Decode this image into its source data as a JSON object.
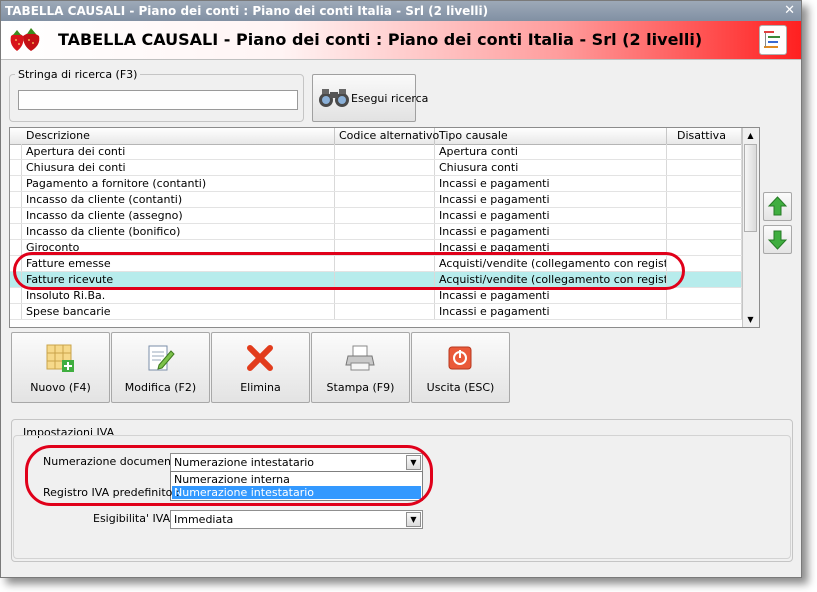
{
  "window": {
    "title": "TABELLA CAUSALI - Piano dei conti : Piano dei conti Italia - Srl (2 livelli)",
    "close_glyph": "✕"
  },
  "header": {
    "title": "TABELLA CAUSALI - Piano dei conti : Piano dei conti Italia - Srl (2 livelli)"
  },
  "search": {
    "legend": "Stringa di ricerca (F3)",
    "value": "",
    "button_label": "Esegui ricerca"
  },
  "table": {
    "columns": [
      "Descrizione",
      "Codice alternativo",
      "Tipo causale",
      "Disattiva"
    ],
    "rows": [
      {
        "descrizione": "Apertura dei conti",
        "codice": "",
        "tipo": "Apertura conti",
        "disattiva": ""
      },
      {
        "descrizione": "Chiusura dei conti",
        "codice": "",
        "tipo": "Chiusura conti",
        "disattiva": ""
      },
      {
        "descrizione": "Pagamento a fornitore (contanti)",
        "codice": "",
        "tipo": "Incassi e pagamenti",
        "disattiva": ""
      },
      {
        "descrizione": "Incasso da cliente (contanti)",
        "codice": "",
        "tipo": "Incassi e pagamenti",
        "disattiva": ""
      },
      {
        "descrizione": "Incasso da cliente (assegno)",
        "codice": "",
        "tipo": "Incassi e pagamenti",
        "disattiva": ""
      },
      {
        "descrizione": "Incasso da cliente (bonifico)",
        "codice": "",
        "tipo": "Incassi e pagamenti",
        "disattiva": ""
      },
      {
        "descrizione": "Giroconto",
        "codice": "",
        "tipo": "Incassi e pagamenti",
        "disattiva": ""
      },
      {
        "descrizione": "Fatture emesse",
        "codice": "",
        "tipo": "Acquisti/vendite (collegamento con registri IVA)",
        "disattiva": ""
      },
      {
        "descrizione": "Fatture ricevute",
        "codice": "",
        "tipo": "Acquisti/vendite (collegamento con registri IVA)",
        "disattiva": ""
      },
      {
        "descrizione": "Insoluto Ri.Ba.",
        "codice": "",
        "tipo": "Incassi e pagamenti",
        "disattiva": ""
      },
      {
        "descrizione": "Spese bancarie",
        "codice": "",
        "tipo": "Incassi e pagamenti",
        "disattiva": ""
      }
    ]
  },
  "toolbar": {
    "new": "Nuovo (F4)",
    "edit": "Modifica (F2)",
    "delete": "Elimina",
    "print": "Stampa (F9)",
    "exit": "Uscita (ESC)"
  },
  "iva": {
    "legend": "Impostazioni IVA",
    "numerazione_label": "Numerazione documenti :",
    "numerazione_value": "Numerazione intestatario",
    "dropdown_options": [
      "Numerazione interna",
      "Numerazione intestatario"
    ],
    "registro_label": "Registro IVA predefinito :",
    "esigibilita_label": "Esigibilita' IVA :",
    "esigibilita_value": "Immediata"
  },
  "colors": {
    "accent_red": "#e0001a",
    "selected_row": "#b7ecec",
    "dropdown_highlight": "#3399ff"
  }
}
